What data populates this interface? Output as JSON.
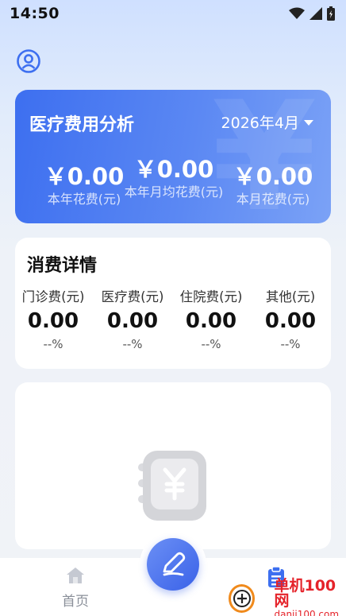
{
  "status_bar": {
    "time": "14:50"
  },
  "summary": {
    "title": "医疗费用分析",
    "date": "2026年4月",
    "stats": [
      {
        "value": "￥0.00",
        "label": "本年花费(元)"
      },
      {
        "value": "￥0.00",
        "label": "本年月均花费(元)"
      },
      {
        "value": "￥0.00",
        "label": "本月花费(元)"
      }
    ]
  },
  "details": {
    "title": "消费详情",
    "columns": [
      {
        "label": "门诊费(元)",
        "value": "0.00",
        "percent": "--%"
      },
      {
        "label": "医疗费(元)",
        "value": "0.00",
        "percent": "--%"
      },
      {
        "label": "住院费(元)",
        "value": "0.00",
        "percent": "--%"
      },
      {
        "label": "其他(元)",
        "value": "0.00",
        "percent": "--%"
      }
    ]
  },
  "nav": {
    "home_label": "首页"
  },
  "watermark": {
    "line1": "单机100网",
    "line2": "danji100.com"
  },
  "colors": {
    "accent": "#3d6ff0",
    "card_gradient_end": "#7ba2f6",
    "watermark": "#e5232a"
  },
  "icons": [
    "user-icon",
    "wifi-icon",
    "signal-icon",
    "battery-icon",
    "home-icon",
    "document-icon",
    "pencil-icon",
    "yen-wallet-icon"
  ]
}
